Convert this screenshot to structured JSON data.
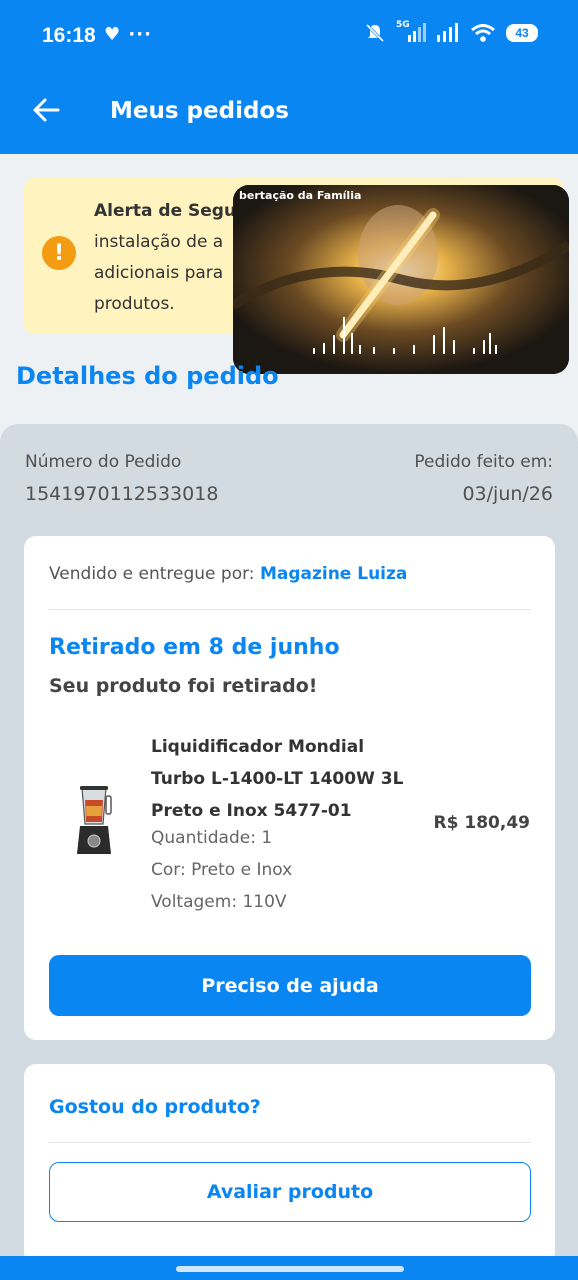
{
  "status_bar": {
    "time": "16:18",
    "left_icons": "♥ ···",
    "network": "5G",
    "battery": "43"
  },
  "app_bar": {
    "title": "Meus pedidos"
  },
  "alert": {
    "title": "Alerta de Segu",
    "lines": [
      "instalação de a",
      "adicionais para",
      "produtos."
    ]
  },
  "video_overlay": {
    "label": "bertação da Família"
  },
  "section_title": "Detalhes do pedido",
  "order": {
    "number_label": "Número do Pedido",
    "number_value": "1541970112533018",
    "date_label": "Pedido feito em:",
    "date_value": "03/jun/26"
  },
  "main_card": {
    "seller_prefix": "Vendido e entregue por:",
    "seller_name": "Magazine Luiza",
    "status_title": "Retirado em 8 de junho",
    "status_sub": "Seu produto foi retirado!",
    "product": {
      "name": "Liquidificador Mondial Turbo L-1400-LT 1400W 3L Preto e Inox 5477-01",
      "quantity": "Quantidade: 1",
      "color": "Cor: Preto e Inox",
      "voltage": "Voltagem: 110V",
      "price": "R$ 180,49"
    },
    "help_button": "Preciso de ajuda"
  },
  "review_card": {
    "title": "Gostou do produto?",
    "button": "Avaliar produto"
  },
  "colors": {
    "primary": "#0a86f2",
    "alert_bg": "#fff3bf",
    "alert_icon": "#f39c12"
  }
}
